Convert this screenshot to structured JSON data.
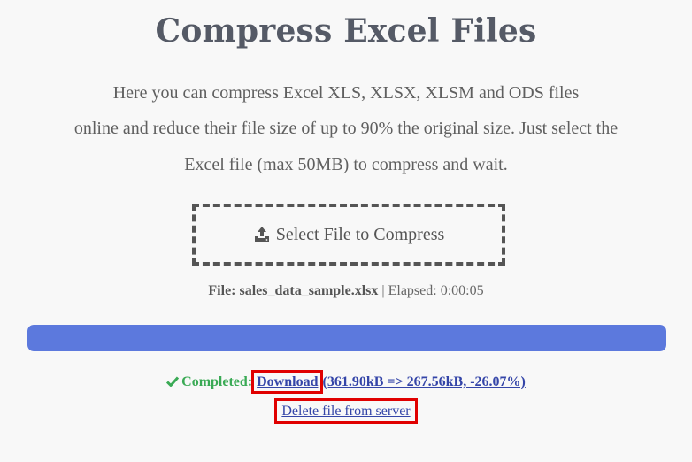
{
  "page": {
    "title": "Compress Excel Files",
    "description_lines": [
      "Here you can compress Excel XLS, XLSX, XLSM and ODS files",
      "online and reduce their file size of up to 90% the original size. Just select the",
      "Excel file (max 50MB) to compress and wait."
    ]
  },
  "upload": {
    "button_label": "Select File to Compress",
    "icon": "upload-icon"
  },
  "status": {
    "file_label": "File:",
    "file_name": "sales_data_sample.xlsx",
    "separator": "|",
    "elapsed_label": "Elapsed:",
    "elapsed_value": "0:00:05",
    "progress_fraction": 1.0
  },
  "result": {
    "check_icon": "check-icon",
    "completed_label": "Completed:",
    "download_label": "Download",
    "size_summary": "(361.90kB => 267.56kB, -26.07%)",
    "delete_label": "Delete file from server"
  },
  "colors": {
    "progress_fill": "#5c79dd",
    "completed_green": "#3aaa55",
    "link_blue": "#3445a8",
    "highlight_red": "#e00000"
  }
}
